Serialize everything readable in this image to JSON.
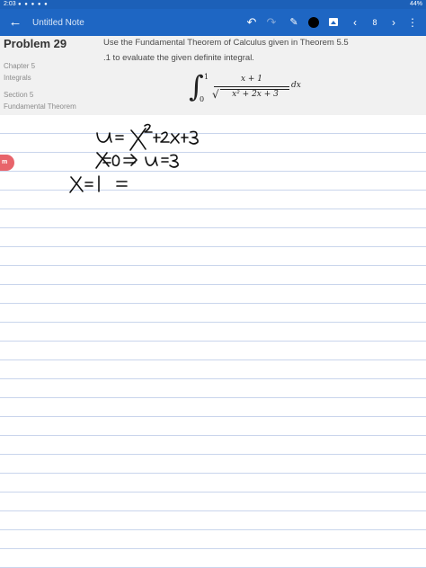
{
  "status_bar": {
    "time": "2:03",
    "icons": "● ● ● ● ●",
    "battery": "44%"
  },
  "toolbar": {
    "title": "Untitled Note",
    "back_glyph": "←",
    "undo_glyph": "↶",
    "redo_glyph": "↷",
    "pen_glyph": "✎",
    "prev_glyph": "‹",
    "page_number": "8",
    "next_glyph": "›",
    "menu_glyph": "⋮",
    "pen_color": "#000000"
  },
  "problem": {
    "title": "Problem 29",
    "chapter": "Chapter 5",
    "chapter_name": "Integrals",
    "section": "Section 5",
    "section_name": "Fundamental Theorem",
    "question_line1": "Use the Fundamental Theorem of Calculus given in Theorem 5.5",
    "question_line2": ".1 to evaluate the given definite integral.",
    "formula": {
      "integral_sign": "∫",
      "upper_limit": "1",
      "lower_limit": "0",
      "numerator": "x + 1",
      "sqrt_sign": "√",
      "denominator": "x² + 2x + 3",
      "differential": "dx"
    }
  },
  "handwriting": [
    "u = x² + 2x + 3",
    "x = 0 ⇒ u = 3",
    "x = 1 ="
  ],
  "badge": {
    "text": "m"
  },
  "colors": {
    "toolbar": "#1e66c3",
    "status_bar": "#1c60b8",
    "header_bg": "#f1f1f1",
    "rule_line": "#c9d5ec",
    "badge": "#e8646b"
  }
}
